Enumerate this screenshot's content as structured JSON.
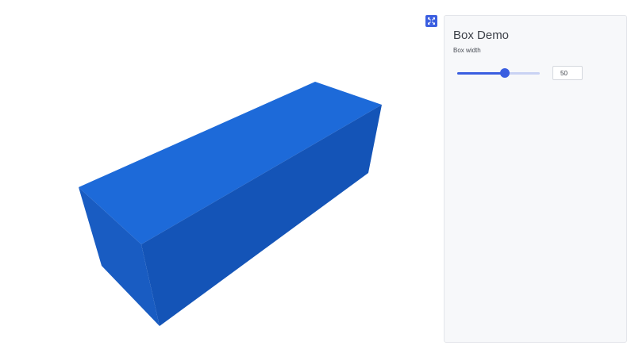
{
  "panel": {
    "title": "Box Demo",
    "field_label": "Box width",
    "box_width_value": "50",
    "slider_fraction": 0.58
  },
  "toolbar": {
    "toggle_icon": "expand-arrows-icon"
  },
  "scene": {
    "object": "box",
    "colors": {
      "top": "#1d6ad9",
      "front": "#1454b7",
      "side": "#195cc2",
      "edge": "#1250a8"
    }
  },
  "theme": {
    "accent": "#3a5ee0",
    "track": "#c9d2f3",
    "panel_bg": "#f7f8fa"
  }
}
